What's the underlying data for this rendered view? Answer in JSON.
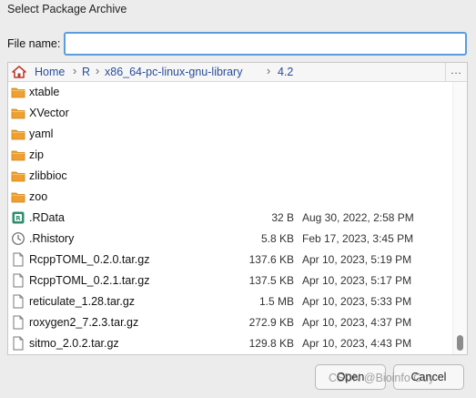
{
  "window": {
    "title": "Select Package Archive"
  },
  "filename": {
    "label": "File name:",
    "value": ""
  },
  "breadcrumb": {
    "items": [
      {
        "label": "Home"
      },
      {
        "label": "R"
      },
      {
        "label": "x86_64-pc-linux-gnu-library"
      },
      {
        "label": "4.2"
      }
    ],
    "more_label": "..."
  },
  "files": [
    {
      "name": "xtable",
      "type": "folder",
      "size": "",
      "modified": ""
    },
    {
      "name": "XVector",
      "type": "folder",
      "size": "",
      "modified": ""
    },
    {
      "name": "yaml",
      "type": "folder",
      "size": "",
      "modified": ""
    },
    {
      "name": "zip",
      "type": "folder",
      "size": "",
      "modified": ""
    },
    {
      "name": "zlibbioc",
      "type": "folder",
      "size": "",
      "modified": ""
    },
    {
      "name": "zoo",
      "type": "folder",
      "size": "",
      "modified": ""
    },
    {
      "name": ".RData",
      "type": "rdata",
      "size": "32 B",
      "modified": "Aug 30, 2022, 2:58 PM"
    },
    {
      "name": ".Rhistory",
      "type": "history",
      "size": "5.8 KB",
      "modified": "Feb 17, 2023, 3:45 PM"
    },
    {
      "name": "RcppTOML_0.2.0.tar.gz",
      "type": "file",
      "size": "137.6 KB",
      "modified": "Apr 10, 2023, 5:19 PM"
    },
    {
      "name": "RcppTOML_0.2.1.tar.gz",
      "type": "file",
      "size": "137.5 KB",
      "modified": "Apr 10, 2023, 5:17 PM"
    },
    {
      "name": "reticulate_1.28.tar.gz",
      "type": "file",
      "size": "1.5 MB",
      "modified": "Apr 10, 2023, 5:33 PM"
    },
    {
      "name": "roxygen2_7.2.3.tar.gz",
      "type": "file",
      "size": "272.9 KB",
      "modified": "Apr 10, 2023, 4:37 PM"
    },
    {
      "name": "sitmo_2.0.2.tar.gz",
      "type": "file",
      "size": "129.8 KB",
      "modified": "Apr 10, 2023, 4:43 PM"
    }
  ],
  "buttons": {
    "open": "Open",
    "cancel": "Cancel"
  },
  "watermark": "CSDN @Bioinfo Guy",
  "colors": {
    "focus": "#5b9ddc",
    "folder": "#f0a030",
    "link": "#2a4f9a"
  }
}
